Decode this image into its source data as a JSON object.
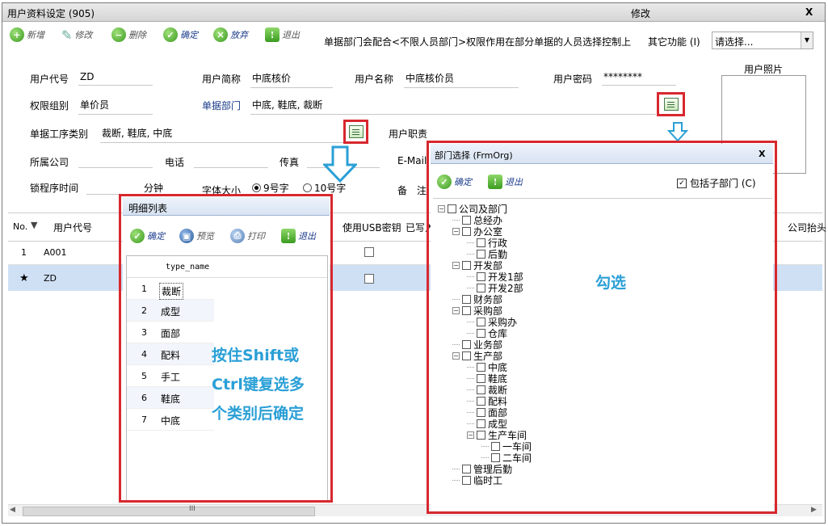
{
  "window": {
    "title": "用户资料设定 (905)",
    "mode": "修改",
    "close": "X"
  },
  "toolbar": {
    "add": "新增",
    "edit": "修改",
    "delete": "删除",
    "confirm": "确定",
    "discard": "放弃",
    "exit": "退出",
    "notice": "单据部门会配合<不限人员部门>权限作用在部分单据的人员选择控制上",
    "other_label": "其它功能 (I)",
    "other_value": "请选择..."
  },
  "form": {
    "user_code_label": "用户代号",
    "user_code": "ZD",
    "user_short_label": "用户简称",
    "user_short": "中底核价",
    "user_name_label": "用户名称",
    "user_name": "中底核价员",
    "password_label": "用户密码",
    "password": "********",
    "photo_label": "用户照片",
    "perm_group_label": "权限组别",
    "perm_group": "单价员",
    "doc_dept_label": "单据部门",
    "doc_dept": "中底, 鞋底, 裁断",
    "process_label": "单据工序类别",
    "process": "裁断, 鞋底, 中底",
    "duty_label": "用户职责",
    "company_label": "所属公司",
    "phone_label": "电话",
    "fax_label": "传真",
    "email_label": "E-Mail",
    "lock_label": "锁程序时间",
    "minutes_label": "分钟",
    "font_label": "字体大小",
    "font_opt1": "9号字",
    "font_opt2": "10号字",
    "note_label": "备　注"
  },
  "grid": {
    "headers": {
      "no": "No.",
      "code": "用户代号",
      "usb": "使用USB密钥",
      "written": "已写入",
      "company": "公司抬头"
    },
    "rows": [
      {
        "no": "1",
        "code": "A001"
      },
      {
        "no": "★",
        "code": "ZD"
      }
    ],
    "scroll_mark": "III"
  },
  "detail": {
    "title": "明细列表",
    "confirm": "确定",
    "preview": "预览",
    "print": "打印",
    "exit": "退出",
    "column": "type_name",
    "rows": [
      {
        "no": "1",
        "name": "裁断"
      },
      {
        "no": "2",
        "name": "成型"
      },
      {
        "no": "3",
        "name": "面部"
      },
      {
        "no": "4",
        "name": "配料"
      },
      {
        "no": "5",
        "name": "手工"
      },
      {
        "no": "6",
        "name": "鞋底"
      },
      {
        "no": "7",
        "name": "中底"
      }
    ]
  },
  "dept": {
    "title": "部门选择 (FrmOrg)",
    "close": "X",
    "confirm": "确定",
    "exit": "退出",
    "include_sub": "包括子部门 (C)",
    "tree": [
      "公司及部门",
      "总经办",
      "办公室",
      "行政",
      "后勤",
      "开发部",
      "开发1部",
      "开发2部",
      "财务部",
      "采购部",
      "采购办",
      "仓库",
      "业务部",
      "生产部",
      "中底",
      "鞋底",
      "裁断",
      "配料",
      "面部",
      "成型",
      "生产车间",
      "一车间",
      "二车间",
      "管理后勤",
      "临时工"
    ]
  },
  "annotations": {
    "check_hint": "勾选",
    "shift_line1": "按住Shift或",
    "shift_line2": "Ctrl键复选多",
    "shift_line3": "个类别后确定"
  },
  "colors": {
    "red": "#d7282f",
    "annot_blue": "#2a9fd6",
    "row_selected": "#cfe0f5"
  }
}
